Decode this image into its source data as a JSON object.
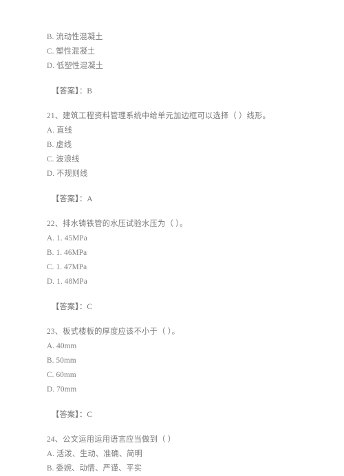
{
  "document": {
    "type": "exam-paper",
    "language": "zh-CN",
    "background_color": "#ffffff",
    "text_color": "#7d7d7d"
  },
  "content": {
    "question_20_tail": {
      "options": [
        "B. 流动性混凝土",
        "C. 塑性混凝土",
        "D. 低塑性混凝土"
      ],
      "answer": "【答案】：B"
    },
    "question_21": {
      "stem": "21、建筑工程资料管理系统中给单元加边框可以选择（    ）线形。",
      "options": [
        "A. 直线",
        "B. 虚线",
        "C. 波浪线",
        "D. 不规则线"
      ],
      "answer": "【答案】：A"
    },
    "question_22": {
      "stem": "22、排水铸铁管的水压试验水压为（    ）。",
      "options": [
        "A. 1. 45MPa",
        "B. 1. 46MPa",
        "C. 1. 47MPa",
        "D. 1. 48MPa"
      ],
      "answer": "【答案】：C"
    },
    "question_23": {
      "stem": "23、板式楼板的厚度应该不小于（    ）。",
      "options": [
        "A. 40mm",
        "B. 50mm",
        "C. 60mm",
        "D. 70mm"
      ],
      "answer": "【答案】：C"
    },
    "question_24": {
      "stem": "24、公文运用运用语言应当做到（    ）",
      "options": [
        "A. 活泼、生动、准确、简明",
        "B. 委婉、动情、严谨、平实"
      ]
    }
  }
}
